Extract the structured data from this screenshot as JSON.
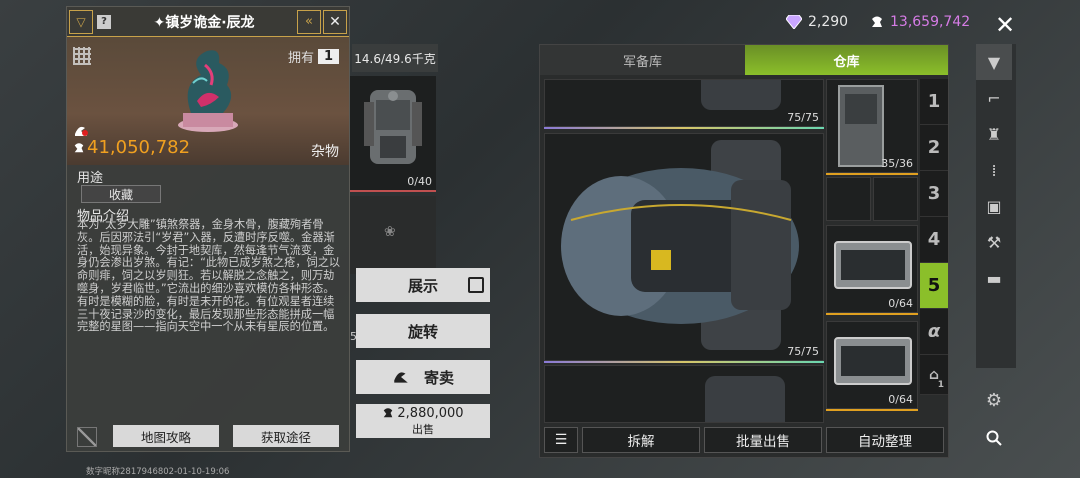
{
  "topbar": {
    "gems": "2,290",
    "coins": "13,659,742",
    "close_label": "✕"
  },
  "detail": {
    "item_name": "镇岁诡金·辰龙",
    "owned_label": "拥有",
    "owned_count": "1",
    "price": "41,050,782",
    "category": "杂物",
    "usage_label": "用途",
    "usage_value": "收藏",
    "desc_label": "物品介绍",
    "desc": "本为“太岁大雕”镇煞祭器，金身木骨，腹藏殉者骨灰。后因邪法引“岁君”入器，反遭时序反噬。金器渐活，始现异象。今封于地契库，然每逢节气流变，金身仍会渗出岁煞。有记：“此物已成岁煞之疮，饲之以命则痱，饲之以岁则狂。若以解脱之念触之，则万劫噬身，岁君临世。”它流出的细沙喜欢模仿各种形态。有时是模糊的脸，有时是未开的花。有位观星者连续三十夜记录沙的变化，最后发现那些形态能拼成一幅完整的星图——指向天空中一个从未有星辰的位置。",
    "map_guide": "地图攻略",
    "get_method": "获取途径",
    "footer": "数字昵称2817946802-01-10-19:06"
  },
  "middle": {
    "capacity": "14.6/49.6千克",
    "bag_count": "0/40",
    "partial_num": "5",
    "btn_display": "展示",
    "btn_rotate": "旋转",
    "btn_sell_consign": "寄卖",
    "sell_price": "2,880,000",
    "sell_label": "出售"
  },
  "storage": {
    "tabs": [
      "军备库",
      "仓库"
    ],
    "active_tab": 1,
    "slot_counts": [
      "75/75",
      "75/75"
    ],
    "side_counts": [
      "35/36",
      "0/64",
      "0/64"
    ],
    "num_tabs": [
      "1",
      "2",
      "3",
      "4",
      "5",
      "α"
    ],
    "active_num": "5",
    "house_num": "1",
    "btn_sort_icon": "list-icon",
    "btn_dismantle": "拆解",
    "btn_batch_sell": "批量出售",
    "btn_auto_arrange": "自动整理"
  },
  "colors": {
    "accent_gold": "#c8a24a",
    "price_orange": "#f0a020",
    "coin_purple": "#d67ce6",
    "active_green": "#8bbf2a",
    "tab_green": "#7aa82a"
  }
}
